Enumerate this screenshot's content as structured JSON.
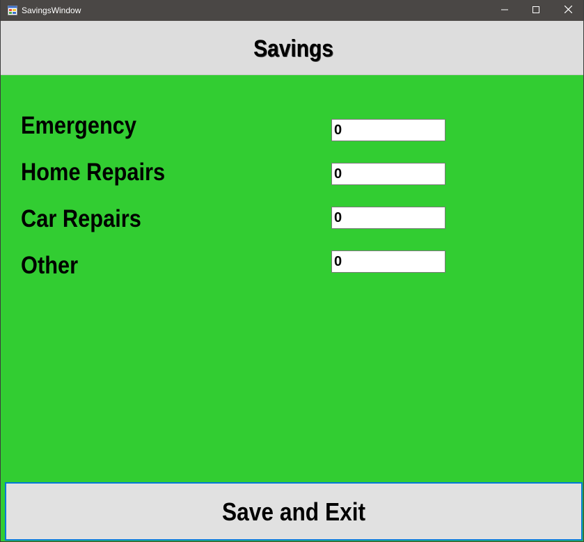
{
  "window": {
    "title": "SavingsWindow"
  },
  "header": {
    "title": "Savings"
  },
  "fields": [
    {
      "label": "Emergency",
      "value": "0"
    },
    {
      "label": "Home Repairs",
      "value": "0"
    },
    {
      "label": "Car Repairs",
      "value": "0"
    },
    {
      "label": "Other",
      "value": "0"
    }
  ],
  "actions": {
    "save_label": "Save and Exit"
  },
  "colors": {
    "background": "#32cd32",
    "header": "#dddddd",
    "titlebar": "#4a4745",
    "button_border": "#0078d7"
  },
  "icons": {
    "app": "app-window-icon",
    "minimize": "minimize-icon",
    "maximize": "maximize-icon",
    "close": "close-icon"
  }
}
